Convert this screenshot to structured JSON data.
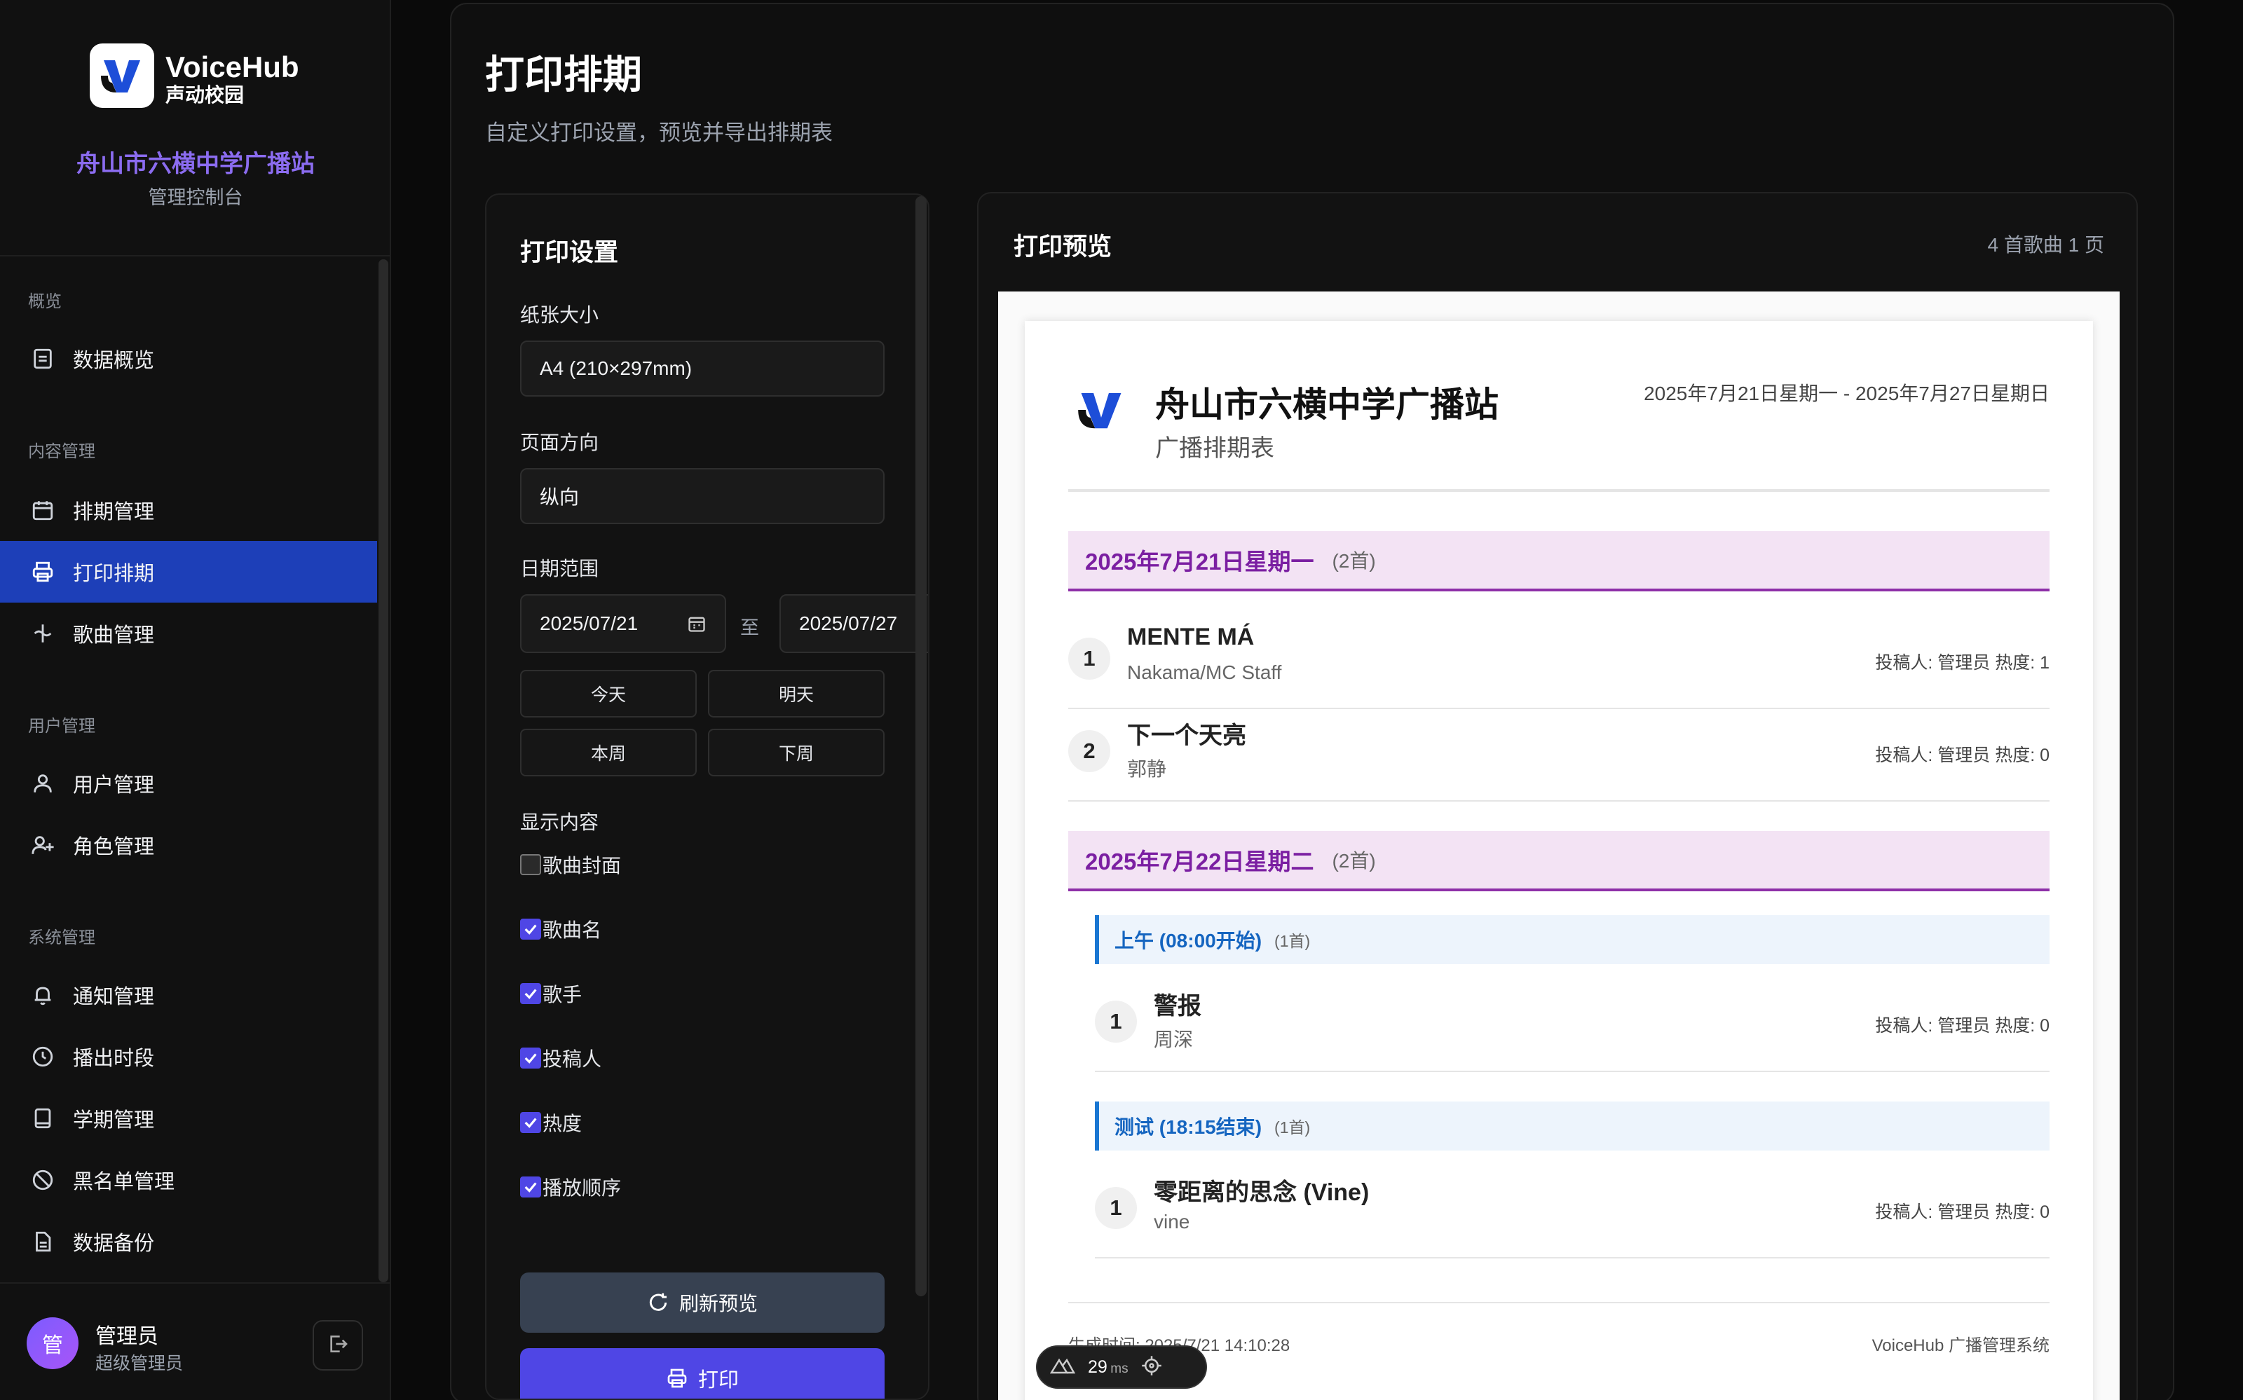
{
  "brand": {
    "name": "VoiceHub",
    "sub": "声动校园",
    "station": "舟山市六横中学广播站",
    "console": "管理控制台"
  },
  "nav": {
    "sections": [
      "概览",
      "内容管理",
      "用户管理",
      "系统管理"
    ],
    "items": [
      {
        "label": "数据概览",
        "icon": "overview-icon"
      },
      {
        "label": "排期管理",
        "icon": "calendar-icon"
      },
      {
        "label": "打印排期",
        "icon": "printer-icon",
        "active": true
      },
      {
        "label": "歌曲管理",
        "icon": "music-icon"
      },
      {
        "label": "用户管理",
        "icon": "user-icon"
      },
      {
        "label": "角色管理",
        "icon": "user-plus-icon"
      },
      {
        "label": "通知管理",
        "icon": "bell-icon"
      },
      {
        "label": "播出时段",
        "icon": "clock-icon"
      },
      {
        "label": "学期管理",
        "icon": "book-icon"
      },
      {
        "label": "黑名单管理",
        "icon": "ban-icon"
      },
      {
        "label": "数据备份",
        "icon": "file-icon"
      }
    ]
  },
  "user": {
    "avatar": "管",
    "name": "管理员",
    "role": "超级管理员"
  },
  "page": {
    "title": "打印排期",
    "desc": "自定义打印设置，预览并导出排期表"
  },
  "settings": {
    "title": "打印设置",
    "paper_label": "纸张大小",
    "paper_value": "A4 (210×297mm)",
    "orientation_label": "页面方向",
    "orientation_value": "纵向",
    "date_label": "日期范围",
    "date_from": "2025/07/21",
    "date_sep": "至",
    "date_to": "2025/07/27",
    "quick": [
      "今天",
      "明天",
      "本周",
      "下周"
    ],
    "display_label": "显示内容",
    "options": [
      {
        "label": "歌曲封面",
        "checked": false
      },
      {
        "label": "歌曲名",
        "checked": true
      },
      {
        "label": "歌手",
        "checked": true
      },
      {
        "label": "投稿人",
        "checked": true
      },
      {
        "label": "热度",
        "checked": true
      },
      {
        "label": "播放顺序",
        "checked": true
      }
    ],
    "refresh": "刷新预览",
    "print": "打印"
  },
  "preview": {
    "title": "打印预览",
    "meta": "4 首歌曲   1 页",
    "station": "舟山市六横中学广播站",
    "sub": "广播排期表",
    "range": "2025年7月21日星期一 - 2025年7月27日星期日",
    "days": [
      {
        "date": "2025年7月21日星期一",
        "count": "(2首)",
        "songs": [
          {
            "num": "1",
            "title": "MENTE MÁ",
            "artist": "Nakama/MC Staff",
            "meta": "投稿人: 管理员   热度: 1"
          },
          {
            "num": "2",
            "title": "下一个天亮",
            "artist": "郭静",
            "meta": "投稿人: 管理员   热度: 0"
          }
        ]
      },
      {
        "date": "2025年7月22日星期二",
        "count": "(2首)",
        "slots": [
          {
            "name": "上午 (08:00开始)",
            "count": "(1首)",
            "song": {
              "num": "1",
              "title": "警报",
              "artist": "周深",
              "meta": "投稿人: 管理员   热度: 0"
            }
          },
          {
            "name": "测试 (18:15结束)",
            "count": "(1首)",
            "song": {
              "num": "1",
              "title": "零距离的思念 (Vine)",
              "artist": "vine",
              "meta": "投稿人: 管理员   热度: 0"
            }
          }
        ]
      }
    ],
    "footer_left": "生成时间: 2025/7/21 14:10:28",
    "footer_right": "VoiceHub 广播管理系统"
  },
  "perf": {
    "value": "29",
    "unit": "ms"
  },
  "colors": {
    "accent": "#4f46e5",
    "active_nav": "#1d3fb8",
    "day_header": "#f3e3f4",
    "day_text": "#7b1fa2",
    "slot_text": "#1565c0"
  }
}
